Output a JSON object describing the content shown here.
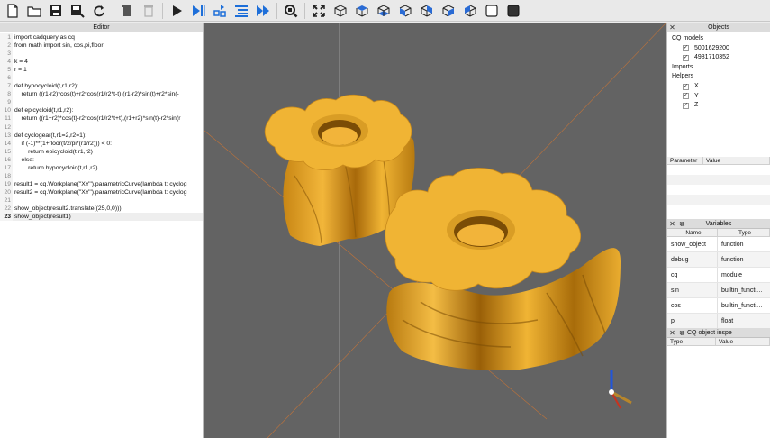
{
  "toolbar": {
    "buttons": [
      "new-file-icon",
      "open-folder-icon",
      "save-icon",
      "save-as-icon",
      "reload-icon",
      "delete-icon",
      "delete-all-icon",
      "run-icon",
      "debug-step-icon",
      "continue-icon",
      "step-in-icon",
      "step-over-icon",
      "fit-icon",
      "zoom-extents-icon",
      "iso-view-icon",
      "top-view-icon",
      "bottom-view-icon",
      "front-view-icon",
      "back-view-icon",
      "left-view-icon",
      "right-view-icon",
      "wireframe-icon",
      "shaded-icon"
    ]
  },
  "editor": {
    "title": "Editor",
    "lines": [
      "import cadquery as cq",
      "from math import sin, cos,pi,floor",
      "",
      "k = 4",
      "r = 1",
      "",
      "def hypocycloid(t,r1,r2):",
      "    return ((r1-r2)*cos(t)+r2*cos(r1/r2*t-t),(r1-r2)*sin(t)+r2*sin(-",
      "",
      "def epicycloid(t,r1,r2):",
      "    return ((r1+r2)*cos(t)-r2*cos(r1/r2*t+t),(r1+r2)*sin(t)-r2*sin(r",
      "",
      "def cyclogear(t,r1=2,r2=1):",
      "    if (-1)**(1+floor(t/2/pi*(r1/r2))) < 0:",
      "        return epicycloid(t,r1,r2)",
      "    else:",
      "        return hypocycloid(t,r1,r2)",
      "",
      "result1 = cq.Workplane(\"XY\").parametricCurve(lambda t: cyclog",
      "result2 = cq.Workplane(\"XY\").parametricCurve(lambda t: cyclog",
      "",
      "show_object(result2.translate((25,0,0)))",
      "show_object(result1)"
    ],
    "current_line": 23
  },
  "objects_panel": {
    "title": "Objects",
    "root": "CQ models",
    "models": [
      "5001629200",
      "4981710352"
    ],
    "imports": "Imports",
    "helpers": "Helpers",
    "helper_items": [
      "X",
      "Y",
      "Z"
    ]
  },
  "parameter_panel": {
    "headers": [
      "Parameter",
      "Value"
    ]
  },
  "variables_panel": {
    "title": "Variables",
    "headers": [
      "Name",
      "Type"
    ],
    "rows": [
      {
        "name": "show_object",
        "type": "function"
      },
      {
        "name": "debug",
        "type": "function"
      },
      {
        "name": "cq",
        "type": "module"
      },
      {
        "name": "sin",
        "type": "builtin_functi…"
      },
      {
        "name": "cos",
        "type": "builtin_functi…"
      },
      {
        "name": "pi",
        "type": "float"
      }
    ]
  },
  "inspector_panel": {
    "title": "CQ object inspe",
    "headers": [
      "Type",
      "Value"
    ]
  },
  "colors": {
    "viewport_bg": "#636363",
    "gear_face": "#f0b434",
    "gear_side": "#d4921a",
    "gear_dark": "#8a5808",
    "accent": "#1e6fd9"
  }
}
